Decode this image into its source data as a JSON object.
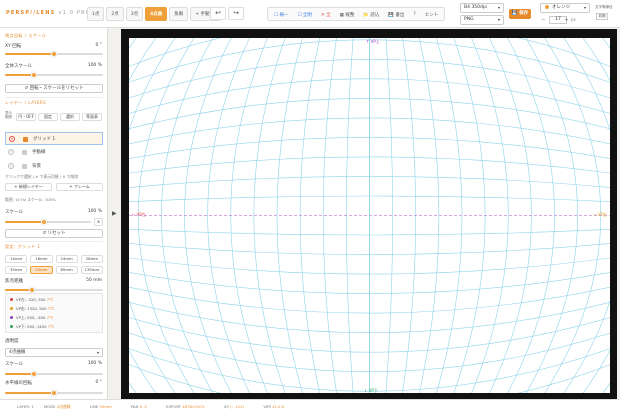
{
  "app": {
    "logo": "PERSP//LENS",
    "version": "v1.0 PRO"
  },
  "mode_tabs": [
    {
      "label": "1点",
      "active": false
    },
    {
      "label": "2点",
      "active": false
    },
    {
      "label": "3点",
      "active": false
    },
    {
      "label": "4点曲",
      "active": true
    },
    {
      "label": "魚眼",
      "active": false
    },
    {
      "label": "+ 手動VP",
      "active": false
    }
  ],
  "toolbar": {
    "undo": "↩",
    "redo": "↪",
    "tools": [
      {
        "label": "☐ 線一",
        "color": "blue"
      },
      {
        "label": "☐ 全明",
        "color": "blue"
      },
      {
        "label": "✕ 全",
        "color": "red"
      },
      {
        "label": "▦ 縦整",
        "color": "default"
      },
      {
        "label": "📁 読込",
        "color": "default"
      },
      {
        "label": "💾 書出",
        "color": "default"
      },
      {
        "label": "?",
        "color": "default"
      },
      {
        "label": "ヒント",
        "color": "default"
      }
    ],
    "paper_size": "B4 350dpi",
    "format": "PNG",
    "save": "💾 保存",
    "color_select": "オレンジ",
    "line_width": "17",
    "unit": "px",
    "size_label": "文字等線径",
    "size_btn": "初期"
  },
  "sidebar": {
    "section_view": "視点回転 / スケール",
    "rotate_label": "XY 回転",
    "rotate_value": "0 °",
    "rotate_fraction": 0.5,
    "scale_label": "全体スケール",
    "scale_value": "100 %",
    "scale_fraction": 0.3,
    "reset_rotate": "↺ 回転・スケールをリセット",
    "section_layers": "レイヤー / LAYERS",
    "layer_row_label": "表示範囲",
    "layer_tools": [
      "円・OFF",
      "固定",
      "選択",
      "等面表"
    ],
    "layers": [
      {
        "name": "グリッド 1",
        "active": true
      },
      {
        "name": "手動線",
        "active": false
      },
      {
        "name": "背景",
        "active": false
      }
    ],
    "layer_hint": "クリックで選択 / ✔ で表示切替 / ✕ で削除",
    "new_layer": "+ 新規レイヤー",
    "frame": "+ フレーム",
    "range_text": "範囲: 10 Hz  スケール: 100%",
    "scale2_label": "スケール",
    "scale2_value": "100 %",
    "scale2_fraction": 0.45,
    "reset_btn": "↺ リセット",
    "section_grid": "設定: グリッド 1",
    "zoom_presets": [
      {
        "label": "14mm",
        "active": false
      },
      {
        "label": "18mm",
        "active": false
      },
      {
        "label": "24mm",
        "active": false
      },
      {
        "label": "28mm",
        "active": false
      },
      {
        "label": "35mm",
        "active": false
      },
      {
        "label": "50mm",
        "active": true
      },
      {
        "label": "85mm",
        "active": false
      },
      {
        "label": "135mm",
        "active": false
      }
    ],
    "focal_label": "焦点距離",
    "focal_value": "50 mm",
    "focal_fraction": 0.28,
    "points": [
      {
        "text": "VP左: -320, 500 ",
        "value": "7℃",
        "color": "#e04040"
      },
      {
        "text": "VP右: 1320, 500 ",
        "value": "7℃",
        "color": "#e0a020"
      },
      {
        "text": "VP上: 500, -400 ",
        "value": "7℃",
        "color": "#9040c0"
      },
      {
        "text": "VP下: 500, 1400 ",
        "value": "7℃",
        "color": "#30a060"
      }
    ],
    "opacity_label": "透明度",
    "mode_select": "4点曲線",
    "scale3_label": "スケール",
    "scale3_value": "100 %",
    "scale3_fraction": 0.3,
    "horizon_label": "水平線の回転",
    "horizon_value": "0 °",
    "horizon_fraction": 0.5
  },
  "canvas": {
    "vp_top": "↑ VP上",
    "vp_left": "← VP左",
    "vp_right": "→ VP右",
    "vp_bottom": "↓ VP下",
    "grid_color": "#8fd3ea",
    "horizon_color": "#c78ad6"
  },
  "status": {
    "layer": "LAYER: 1",
    "mode_k": "MODE",
    "mode_v": "4点曲線",
    "line_k": "LINE",
    "line_v": "50mm",
    "pan_k": "PAN",
    "pan_v": "0, 0",
    "export_k": "EXPORT",
    "export_v": "4878×3472",
    "xy_k": "XY",
    "xy_v": "(-, 122)",
    "ver_k": "VER",
    "ver_v": "v1.0.0"
  }
}
